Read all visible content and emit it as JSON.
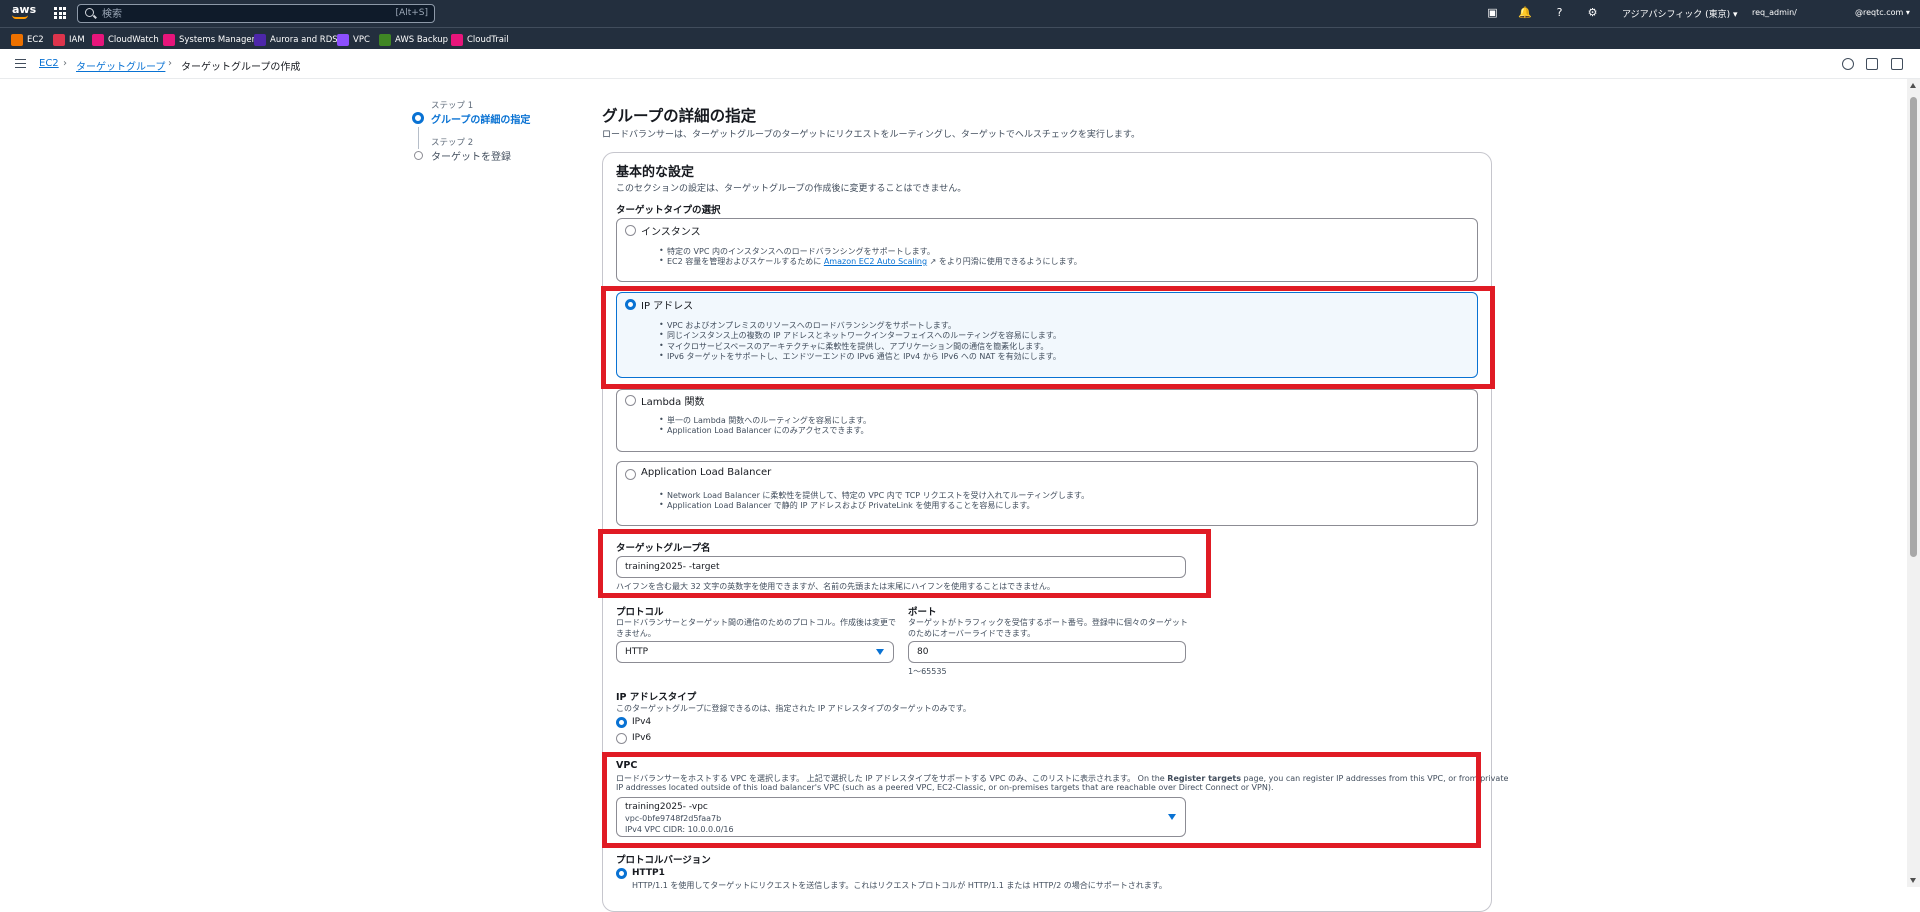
{
  "topbar": {
    "search_placeholder": "検索",
    "search_shortcut": "[Alt+S]",
    "region": "アジアパシフィック (東京)",
    "user": "req_admin/",
    "account": "@reqtc.com"
  },
  "favorites": [
    {
      "label": "EC2",
      "color": "#ed7100"
    },
    {
      "label": "IAM",
      "color": "#dd344c"
    },
    {
      "label": "CloudWatch",
      "color": "#e7157b"
    },
    {
      "label": "Systems Manager",
      "color": "#e7157b"
    },
    {
      "label": "Aurora and RDS",
      "color": "#4d27aa"
    },
    {
      "label": "VPC",
      "color": "#8c4fff"
    },
    {
      "label": "AWS Backup",
      "color": "#3f8624"
    },
    {
      "label": "CloudTrail",
      "color": "#e7157b"
    }
  ],
  "breadcrumb": {
    "ec2": "EC2",
    "target_groups": "ターゲットグループ",
    "current": "ターゲットグループの作成"
  },
  "steps": [
    {
      "num": "ステップ 1",
      "title": "グループの詳細の指定"
    },
    {
      "num": "ステップ 2",
      "title": "ターゲットを登録"
    }
  ],
  "page": {
    "title": "グループの詳細の指定",
    "description": "ロードバランサーは、ターゲットグループのターゲットにリクエストをルーティングし、ターゲットでヘルスチェックを実行します。"
  },
  "basic": {
    "title": "基本的な設定",
    "description": "このセクションの設定は、ターゲットグループの作成後に変更することはできません。",
    "target_type_label": "ターゲットタイプの選択"
  },
  "target_types": [
    {
      "title": "インスタンス",
      "bullets": [
        "特定の VPC 内のインスタンスへのロードバランシングをサポートします。",
        "EC2 容量を管理およびスケールするために",
        "をより円滑に使用できるようにします。"
      ],
      "link": "Amazon EC2 Auto Scaling"
    },
    {
      "title": "IP アドレス",
      "bullets": [
        "VPC およびオンプレミスのリソースへのロードバランシングをサポートします。",
        "同じインスタンス上の複数の IP アドレスとネットワークインターフェイスへのルーティングを容易にします。",
        "マイクロサービスベースのアーキテクチャに柔軟性を提供し、アプリケーション間の通信を簡素化します。",
        "IPv6 ターゲットをサポートし、エンドツーエンドの IPv6 通信と IPv4 から IPv6 への NAT を有効にします。"
      ]
    },
    {
      "title": "Lambda 関数",
      "bullets": [
        "単一の Lambda 関数へのルーティングを容易にします。",
        "Application Load Balancer にのみアクセスできます。"
      ]
    },
    {
      "title": "Application Load Balancer",
      "bullets": [
        "Network Load Balancer に柔軟性を提供して、特定の VPC 内で TCP リクエストを受け入れてルーティングします。",
        "Application Load Balancer で静的 IP アドレスおよび PrivateLink を使用することを容易にします。"
      ]
    }
  ],
  "tg_name": {
    "label": "ターゲットグループ名",
    "value": "training2025-      -target",
    "hint": "ハイフンを含む最大 32 文字の英数字を使用できますが、名前の先頭または末尾にハイフンを使用することはできません。"
  },
  "protocol": {
    "label": "プロトコル",
    "description": "ロードバランサーとターゲット間の通信のためのプロトコル。作成後は変更できません。",
    "value": "HTTP"
  },
  "port": {
    "label": "ポート",
    "description": "ターゲットがトラフィックを受信するポート番号。登録中に個々のターゲットのためにオーバーライドできます。",
    "value": "80",
    "range": "1〜65535"
  },
  "ip_type": {
    "label": "IP アドレスタイプ",
    "description": "このターゲットグループに登録できるのは、指定された IP アドレスタイプのターゲットのみです。",
    "options": [
      "IPv4",
      "IPv6"
    ]
  },
  "vpc": {
    "label": "VPC",
    "description_1a": "ロードバランサーをホストする VPC を選択します。 上記で選択した IP アドレスタイプをサポートする VPC のみ、このリストに表示されます。 On the ",
    "description_1b": "Register targets",
    "description_1c": " page, you can register IP addresses from this VPC, or from private",
    "description_2": "IP addresses located outside of this load balancer's VPC (such as a peered VPC, EC2-Classic, or on-premises targets that are reachable over Direct Connect or VPN).",
    "name": "training2025-      -vpc",
    "id": "vpc-0bfe9748f2d5faa7b",
    "cidr": "IPv4 VPC CIDR: 10.0.0.0/16"
  },
  "protocol_version": {
    "label": "プロトコルバージョン",
    "option": "HTTP1",
    "description": "HTTP/1.1 を使用してターゲットにリクエストを送信します。これはリクエストプロトコルが HTTP/1.1 または HTTP/2 の場合にサポートされます。"
  },
  "colors": {
    "accent": "#0972d3",
    "header": "#232f3e",
    "highlight": "#e01b24"
  }
}
